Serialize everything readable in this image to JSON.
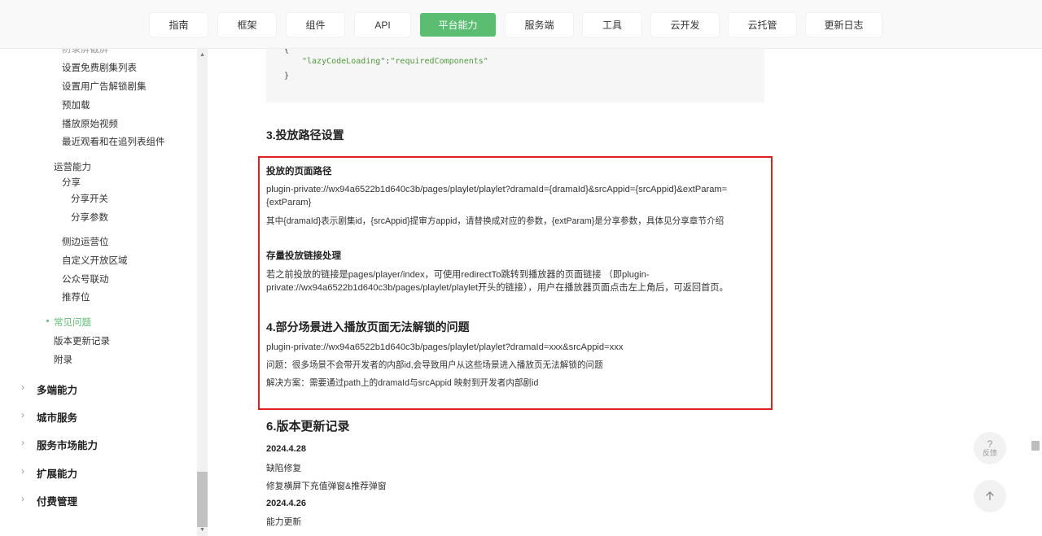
{
  "nav": {
    "tabs": [
      "指南",
      "框架",
      "组件",
      "API",
      "平台能力",
      "服务端",
      "工具",
      "云开发",
      "云托管",
      "更新日志"
    ],
    "active": "平台能力"
  },
  "sidebar": {
    "cut_item": "防录屏截屏",
    "items_a": [
      "设置免费剧集列表",
      "设置用广告解锁剧集",
      "预加载",
      "播放原始视频",
      "最近观看和在追列表组件"
    ],
    "ops_title": "运营能力",
    "share": "分享",
    "share_sub": [
      "分享开关",
      "分享参数"
    ],
    "items_b": [
      "侧边运营位",
      "自定义开放区域",
      "公众号联动",
      "推荐位"
    ],
    "faq": "常见问题",
    "changelog": "版本更新记录",
    "appendix": "附录",
    "sections": [
      "多端能力",
      "城市服务",
      "服务市场能力",
      "扩展能力",
      "付费管理"
    ]
  },
  "code": {
    "open": "{",
    "key": "\"lazyCodeLoading\"",
    "colon": ":",
    "value": "\"requiredComponents\"",
    "close": "}"
  },
  "content": {
    "h3_path": "3.投放路径设置",
    "page_path_title": "投放的页面路径",
    "page_path_line1": "plugin-private://wx94a6522b1d640c3b/pages/playlet/playlet?dramaId={dramaId}&srcAppid={srcAppid}&extParam=",
    "page_path_line2": "{extParam}",
    "page_path_desc": "其中{dramaId}表示剧集id，{srcAppid}提审方appid，请替换成对应的参数，{extParam}是分享参数，具体见分享章节介绍",
    "stock_title": "存量投放链接处理",
    "stock_line1": "若之前投放的链接是pages/player/index，可使用redirectTo跳转到播放器的页面链接 （即plugin-",
    "stock_line2": "private://wx94a6522b1d640c3b/pages/playlet/playlet开头的链接），用户在播放器页面点击左上角后，可返回首页。",
    "h3_unlock": "4.部分场景进入播放页面无法解锁的问题",
    "unlock_url": "plugin-private://wx94a6522b1d640c3b/pages/playlet/playlet?dramaId=xxx&srcAppid=xxx",
    "unlock_problem": "问题：很多场景不会带开发者的内部id,会导致用户从这些场景进入播放页无法解锁的问题",
    "unlock_solution": "解决方案：需要通过path上的dramaId与srcAppid 映射到开发者内部剧id",
    "h3_changelog": "6.版本更新记录",
    "v1_date": "2024.4.28",
    "v1_items": [
      "缺陷修复",
      "修复横屏下充值弹窗&推荐弹窗"
    ],
    "v2_date": "2024.4.26",
    "v2_items": [
      "能力更新"
    ]
  },
  "floats": {
    "feedback_icon": "?",
    "feedback_label": "反馈",
    "top_icon": "arrow-up-icon"
  },
  "colors": {
    "accent": "#5bbd72",
    "highlight_box": "#e02020"
  }
}
